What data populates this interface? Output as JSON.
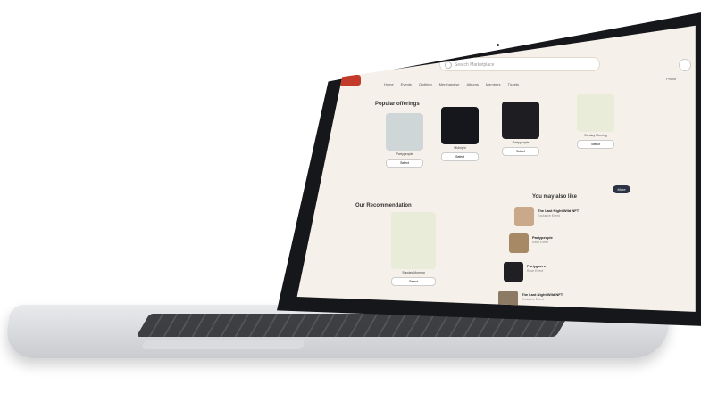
{
  "header": {
    "search_placeholder": "Search Marketplace",
    "profile_label": "Profile",
    "nav": [
      "Home",
      "Events",
      "Clothing",
      "Merchandise",
      "Albums",
      "Members",
      "Tickets"
    ]
  },
  "sections": {
    "popular": "Popular offerings",
    "recommendation": "Our Recommendation",
    "also_like": "You may also like"
  },
  "popular_cards": [
    {
      "title": "Partypeople",
      "btn": "Select"
    },
    {
      "title": "Midnight",
      "btn": "Select"
    },
    {
      "title": "Partypeople",
      "btn": "Select"
    },
    {
      "title": "Sunday Morning",
      "btn": "Select"
    }
  ],
  "more_label": "More",
  "recommendation_card": {
    "title": "Sunday Morning",
    "btn": "Select"
  },
  "also_like_items": [
    {
      "title": "The Last Night Wild NFT",
      "sub": "Exclusive Event"
    },
    {
      "title": "Partypeople",
      "sub": "Rave Event"
    },
    {
      "title": "Partygoers",
      "sub": "Rave Event"
    },
    {
      "title": "The Last Night Wild NFT",
      "sub": "Exclusive Event"
    }
  ],
  "colors": {
    "brand": "#c43a2a",
    "screen_bg": "#f5f1ea",
    "more_button": "#2c3345",
    "accent_green": "#4caf50"
  }
}
